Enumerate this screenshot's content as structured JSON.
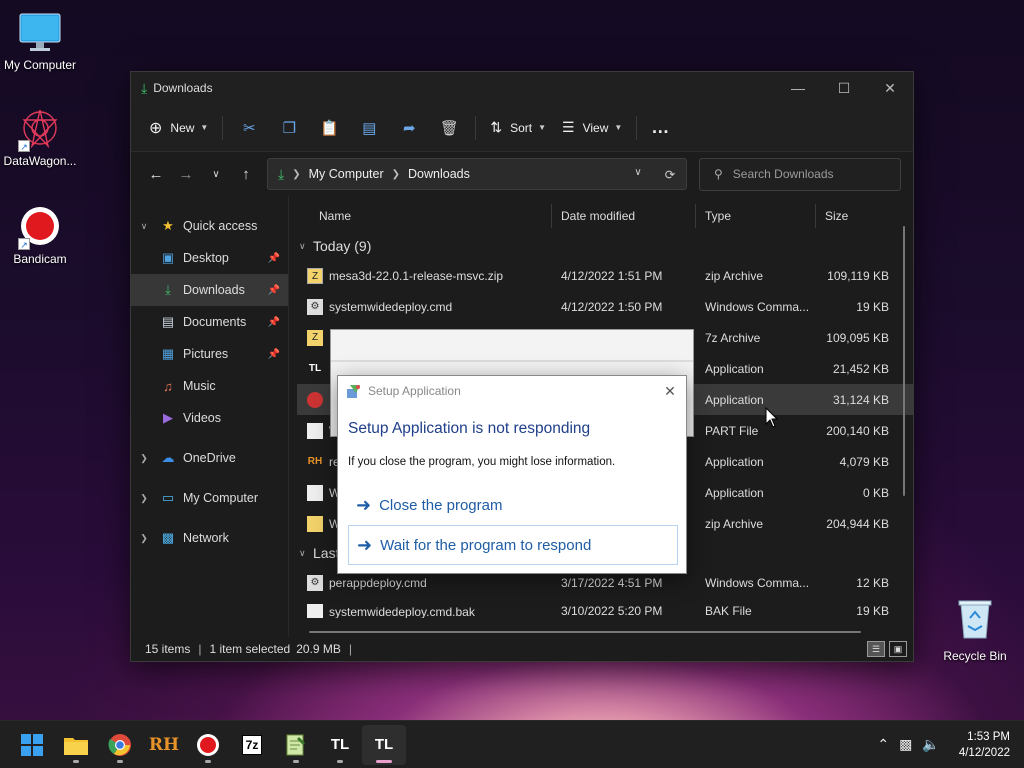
{
  "desktop": {
    "icons": [
      {
        "label": "My Computer"
      },
      {
        "label": "DataWagon..."
      },
      {
        "label": "Bandicam"
      }
    ],
    "recycle_bin": "Recycle Bin"
  },
  "explorer": {
    "title": "Downloads",
    "toolbar": {
      "new_label": "New",
      "sort_label": "Sort",
      "view_label": "View",
      "more_label": "…"
    },
    "address": {
      "segments": [
        "My Computer",
        "Downloads"
      ]
    },
    "search": {
      "placeholder": "Search Downloads"
    },
    "nav": {
      "quick_access": "Quick access",
      "items": [
        {
          "label": "Desktop"
        },
        {
          "label": "Downloads"
        },
        {
          "label": "Documents"
        },
        {
          "label": "Pictures"
        },
        {
          "label": "Music"
        },
        {
          "label": "Videos"
        }
      ],
      "onedrive": "OneDrive",
      "my_computer": "My Computer",
      "network": "Network"
    },
    "columns": {
      "name": "Name",
      "date": "Date modified",
      "type": "Type",
      "size": "Size"
    },
    "groups": {
      "today": "Today (9)",
      "last": "Last"
    },
    "files": [
      {
        "name": "mesa3d-22.0.1-release-msvc.zip",
        "date": "4/12/2022 1:51 PM",
        "type": "zip Archive",
        "size": "109,119 KB"
      },
      {
        "name": "systemwidedeploy.cmd",
        "date": "4/12/2022 1:50 PM",
        "type": "Windows Comma...",
        "size": "19 KB"
      },
      {
        "name": "",
        "date": "",
        "type": "7z Archive",
        "size": "109,095 KB"
      },
      {
        "name": "",
        "date": "",
        "type": "Application",
        "size": "21,452 KB"
      },
      {
        "name": "",
        "date": "",
        "type": "Application",
        "size": "31,124 KB"
      },
      {
        "name": "W",
        "date": "",
        "type": "PART File",
        "size": "200,140 KB"
      },
      {
        "name": "re",
        "date": "",
        "type": "Application",
        "size": "4,079 KB"
      },
      {
        "name": "W",
        "date": "",
        "type": "Application",
        "size": "0 KB"
      },
      {
        "name": "W",
        "date": "",
        "type": "zip Archive",
        "size": "204,944 KB"
      }
    ],
    "last_files": [
      {
        "name": "perappdeploy.cmd",
        "date": "3/17/2022 4:51 PM",
        "type": "Windows Comma...",
        "size": "12 KB"
      },
      {
        "name": "systemwidedeploy.cmd.bak",
        "date": "3/10/2022 5:20 PM",
        "type": "BAK File",
        "size": "19 KB"
      }
    ],
    "status": {
      "items": "15 items",
      "selected": "1 item selected",
      "size": "20.9 MB"
    }
  },
  "dialog": {
    "title": "Setup Application",
    "heading": "Setup Application is not responding",
    "message": "If you close the program, you might lose information.",
    "option_close": "Close the program",
    "option_wait": "Wait for the program to respond"
  },
  "taskbar": {
    "clock_time": "1:53 PM",
    "clock_date": "4/12/2022"
  }
}
